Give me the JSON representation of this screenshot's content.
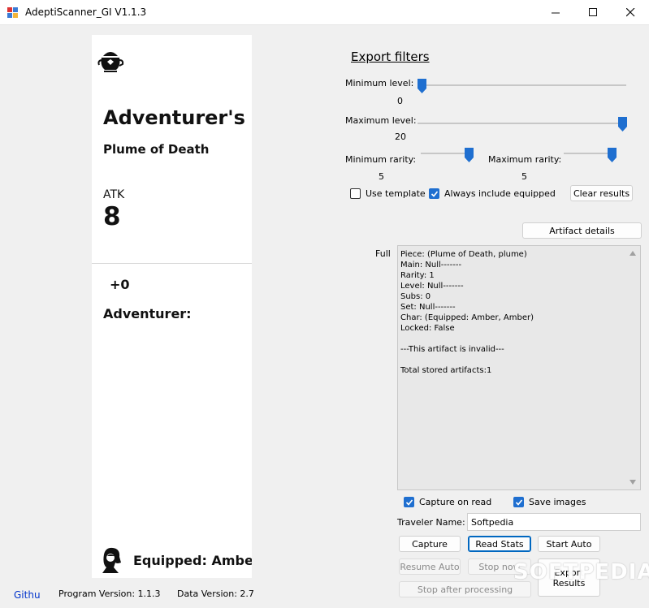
{
  "window": {
    "title": "AdeptiScanner_GI V1.1.3",
    "controls": {
      "minimize": "minimize-icon",
      "maximize": "maximize-icon",
      "close": "close-icon"
    }
  },
  "preview": {
    "set_icon": "teapot-icon",
    "title": "Adventurer's T",
    "piece": "Plume of Death",
    "main_stat": "ATK",
    "main_value": "8",
    "level": "+0",
    "set": "Adventurer:",
    "equipped": "Equipped: Amber",
    "char_icon": "character-icon"
  },
  "export_filters": {
    "title": "Export filters",
    "min_level": {
      "label": "Minimum level:",
      "value": "0",
      "min": 0,
      "max": 20,
      "current": 0
    },
    "max_level": {
      "label": "Maximum level:",
      "value": "20",
      "min": 0,
      "max": 20,
      "current": 20
    },
    "min_rarity": {
      "label": "Minimum rarity:",
      "value": "5",
      "min": 1,
      "max": 5,
      "current": 5
    },
    "max_rarity": {
      "label": "Maximum rarity:",
      "value": "5",
      "min": 1,
      "max": 5,
      "current": 5
    },
    "use_template": {
      "label": "Use template",
      "checked": false
    },
    "always_equipped": {
      "label": "Always include equipped",
      "checked": true
    },
    "clear_results": "Clear results"
  },
  "details": {
    "button": "Artifact details",
    "mode_label": "Full",
    "text": "Piece: (Plume of Death, plume)\nMain: Null-------\nRarity: 1\nLevel: Null-------\nSubs: 0\nSet: Null-------\nChar: (Equipped: Amber, Amber)\nLocked: False\n\n---This artifact is invalid---\n\nTotal stored artifacts:1"
  },
  "options": {
    "capture_on_read": {
      "label": "Capture on read",
      "checked": true
    },
    "save_images": {
      "label": "Save images",
      "checked": true
    }
  },
  "traveler": {
    "label": "Traveler Name:",
    "value": "Softpedia"
  },
  "buttons": {
    "capture": "Capture",
    "read_stats": "Read Stats",
    "start_auto": "Start Auto",
    "resume_auto": "Resume Auto",
    "stop_now": "Stop now",
    "export_results": "Export Results",
    "stop_after": "Stop after processing"
  },
  "footer": {
    "github": "Githu",
    "program_version": "Program Version: 1.1.3",
    "data_version": "Data Version: 2.7"
  },
  "watermark": "SOFTPEDIA",
  "colors": {
    "accent": "#1f6fd0",
    "slider_thumb": "#1f6fd0",
    "link": "#0033cc",
    "background": "#f0f0f0"
  }
}
